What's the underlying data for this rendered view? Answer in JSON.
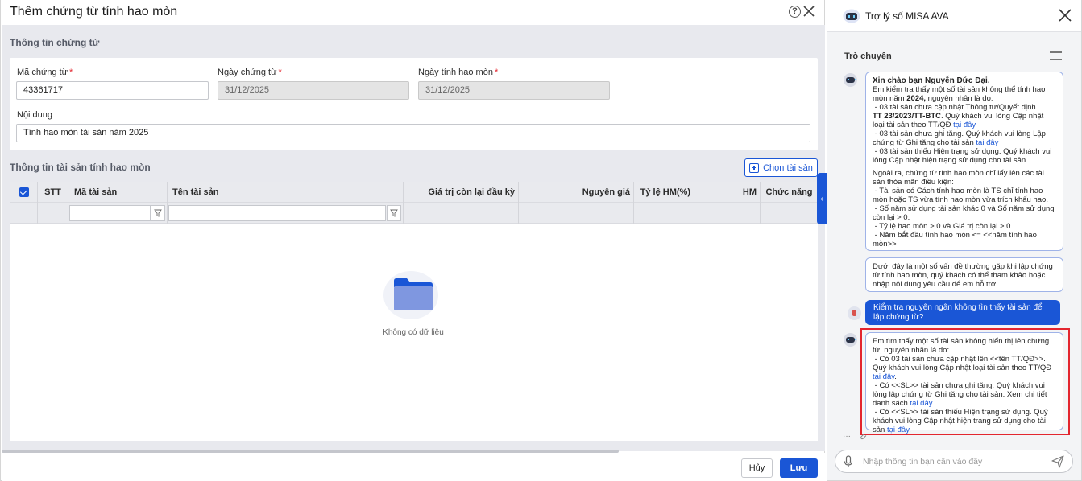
{
  "dialog": {
    "title": "Thêm chứng từ tính hao mòn",
    "section_voucher": "Thông tin chứng từ",
    "fields": {
      "voucher_no_label": "Mã chứng từ",
      "voucher_no_value": "43361717",
      "voucher_date_label": "Ngày chứng từ",
      "voucher_date_value": "31/12/2025",
      "calc_date_label": "Ngày tính hao mòn",
      "calc_date_value": "31/12/2025",
      "content_label": "Nội dung",
      "content_value": "Tính hao mòn tài sản năm 2025",
      "required_mark": "*"
    },
    "section_assets": "Thông tin tài sản tính hao mòn",
    "choose_asset_button": "Chọn tài sản",
    "grid": {
      "columns": [
        "STT",
        "Mã tài sản",
        "Tên tài sản",
        "Giá trị còn lại đầu kỳ",
        "Nguyên giá",
        "Tỷ lệ HM(%)",
        "HM",
        "Chức năng"
      ],
      "empty_text": "Không có dữ liệu"
    },
    "cancel_button": "Hủy",
    "save_button": "Lưu",
    "collapse_icon": "‹"
  },
  "assistant": {
    "title": "Trợ lý số MISA AVA",
    "conversation_label": "Trò chuyện",
    "messages": {
      "m1": {
        "greeting": "Xin chào bạn Nguyễn Đức Đại,",
        "l1": "Em kiểm tra thấy một số tài sản không thể tính hao mòn năm",
        "l1_bold": "2024,",
        "l1_tail": "nguyên nhân là do:",
        "l2": "- 03 tài sản chưa cập nhật Thông tư/Quyết định",
        "l3_bold": "TT 23/2023/TT-BTC",
        "l3": ". Quý khách vui lòng Cập nhật loại tài sản theo TT/QĐ",
        "link": "tại đây",
        "l4": "- 03 tài sản chưa ghi tăng. Quý khách vui lòng Lập chứng từ Ghi tăng cho tài sản",
        "l5": "- 03 tài sản thiếu Hiện trạng sử dụng. Quý khách vui lòng Cập nhật hiện trạng sử dụng cho tài sản",
        "l6": "Ngoài ra, chứng từ tính hao mòn chỉ lấy lên các tài sản thỏa mãn điều kiện:",
        "l7": "- Tài sản có Cách tính hao mòn là TS chỉ tính hao mòn hoặc TS vừa tính hao mòn vừa trích khấu hao.",
        "l8": "- Số năm sử dụng tài sản khác 0 và Số năm sử dụng còn lại > 0.",
        "l9": "- Tỷ lệ hao mòn > 0 và Giá trị còn lại > 0.",
        "l10": "- Năm bắt đầu tính hao mòn <= <<năm tính hao mòn>>"
      },
      "m2": "Dưới đây là một số vấn đề thường gặp khi lập chứng từ tính hao mòn, quý khách có thể tham khảo hoặc nhập nội dung yêu cầu để em hỗ trợ.",
      "user": "Kiểm tra nguyên ngân không tìn thấy tài sản để lập chứng từ?",
      "m3": {
        "l1": "Em tìm thấy một số tài sản không hiển thị lên chứng từ, nguyên nhân là do:",
        "l2": "- Có 03 tài sản chưa cập nhật lên <<tên TT/QĐ>>. Quý khách vui lòng Cập nhật loại tài sản theo TT/QĐ",
        "l3": "- Có <<SL>> tài sản chưa ghi tăng. Quý khách vui lòng lập chứng từ Ghi tăng cho tài sản. Xem chi tiết danh sách",
        "l4": "- Có <<SL>> tài sản thiếu Hiện trạng sử dụng. Quý khách vui lòng Cập nhật hiện trạng sử dụng cho tài sản",
        "link": "tại đây"
      }
    },
    "more_icon": "···",
    "input_placeholder": "Nhập thông tin bạn cần vào đây"
  },
  "colors": {
    "accent": "#1a56d6",
    "required": "#e3262f",
    "highlight": "#e3262f",
    "panel_bg": "#e8e9ee"
  }
}
